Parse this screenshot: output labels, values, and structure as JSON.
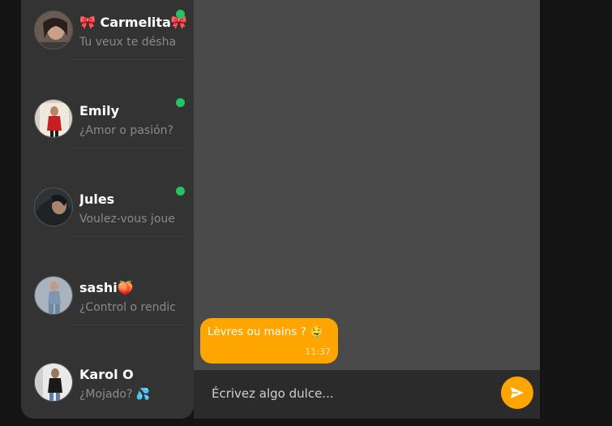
{
  "contacts": [
    {
      "name": "🎀 Carmelita🎀",
      "preview": "Tu veux te désha",
      "online": true,
      "avatar_icon": "avatar-photo"
    },
    {
      "name": "Emily",
      "preview": "¿Amor o pasión?",
      "online": true,
      "avatar_icon": "avatar-photo"
    },
    {
      "name": "Jules",
      "preview": "Voulez-vous jouer",
      "online": true,
      "avatar_icon": "avatar-photo"
    },
    {
      "name": "sashi🍑",
      "preview": "¿Control o rendición",
      "online": false,
      "avatar_icon": "avatar-photo"
    },
    {
      "name": "Karol O",
      "preview": "¿Mojado? 💦",
      "online": false,
      "avatar_icon": "avatar-photo"
    }
  ],
  "chat": {
    "messages": [
      {
        "text": "Lèvres ou mains ? 🤤",
        "time": "11:37"
      }
    ]
  },
  "composer": {
    "placeholder": "Écrivez algo dulce...",
    "send_icon": "send-icon"
  },
  "colors": {
    "accent": "#ffa500",
    "online": "#22c55e",
    "sidebar": "#333333",
    "chat_bg": "#4a4a4a"
  }
}
